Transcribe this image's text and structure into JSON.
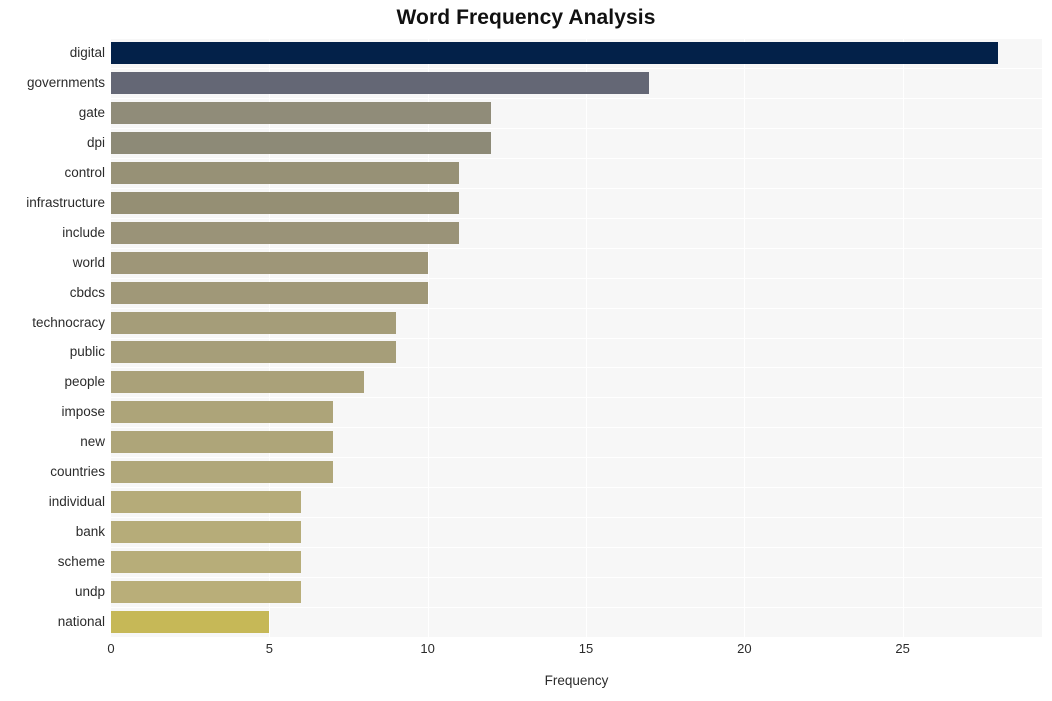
{
  "chart_data": {
    "type": "bar",
    "orientation": "horizontal",
    "title": "Word Frequency Analysis",
    "xlabel": "Frequency",
    "ylabel": "",
    "categories": [
      "digital",
      "governments",
      "gate",
      "dpi",
      "control",
      "infrastructure",
      "include",
      "world",
      "cbdcs",
      "technocracy",
      "public",
      "people",
      "impose",
      "new",
      "countries",
      "individual",
      "bank",
      "scheme",
      "undp",
      "national"
    ],
    "values": [
      28,
      17,
      12,
      12,
      11,
      11,
      11,
      10,
      10,
      9,
      9,
      8,
      7,
      7,
      7,
      6,
      6,
      6,
      6,
      5
    ],
    "bar_colors": [
      "#032149",
      "#646775",
      "#908c79",
      "#8d8a77",
      "#979176",
      "#958f74",
      "#9a9378",
      "#9e9678",
      "#a09878",
      "#a59d79",
      "#a69e79",
      "#aaa179",
      "#ada479",
      "#aea579",
      "#b0a77a",
      "#b5ab79",
      "#b6ac79",
      "#b7ad79",
      "#b9ae79",
      "#c6b857"
    ],
    "xlim": [
      0,
      29.4
    ],
    "xticks": [
      0,
      5,
      10,
      15,
      20,
      25
    ],
    "xtick_labels": [
      "0",
      "5",
      "10",
      "15",
      "20",
      "25"
    ],
    "grid": true,
    "grid_color": "#ffffff",
    "plot_background": "#f7f7f7",
    "figure_background": "#ffffff",
    "legend": null,
    "legend_position": "none",
    "title_color": "#111111",
    "tick_label_color": "#2b2b2b"
  }
}
